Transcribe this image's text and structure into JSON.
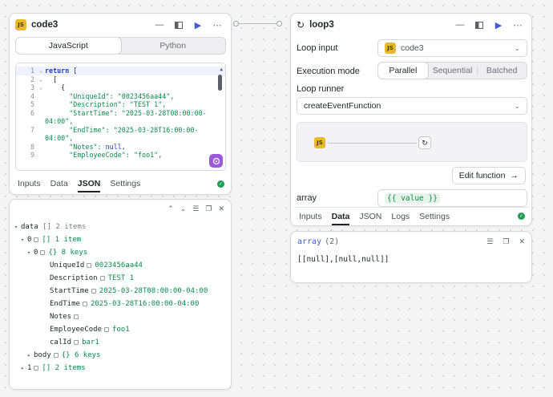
{
  "code_node": {
    "title": "code3",
    "badge": "JS",
    "language_tabs": [
      "JavaScript",
      "Python"
    ],
    "code_lines": [
      {
        "n": "1",
        "fold": "⌄",
        "text": "return ["
      },
      {
        "n": "2",
        "fold": "⌄",
        "text": "  ["
      },
      {
        "n": "3",
        "fold": "⌄",
        "text": "    {"
      },
      {
        "n": "4",
        "fold": "",
        "key": "      \"UniqueId\": ",
        "val": "\"0023456aa44\","
      },
      {
        "n": "5",
        "fold": "",
        "key": "      \"Description\": ",
        "val": "\"TEST 1\","
      },
      {
        "n": "6",
        "fold": "",
        "key": "      \"StartTime\": ",
        "val": "\"2025-03-28T08:00:00-"
      },
      {
        "n": "",
        "fold": "",
        "key": "",
        "val": "04:00\","
      },
      {
        "n": "7",
        "fold": "",
        "key": "      \"EndTime\": ",
        "val": "\"2025-03-28T16:00:00-"
      },
      {
        "n": "",
        "fold": "",
        "key": "",
        "val": "04:00\","
      },
      {
        "n": "8",
        "fold": "",
        "key": "      \"Notes\": ",
        "val": "null,"
      },
      {
        "n": "9",
        "fold": "",
        "key": "      \"EmployeeCode\": ",
        "val": "\"foo1\","
      }
    ],
    "bottom_tabs": [
      "Inputs",
      "Data",
      "JSON",
      "Settings"
    ],
    "active_tab": "JSON"
  },
  "json_panel": {
    "root": {
      "key": "data",
      "meta": "[]  2 items"
    },
    "rows": [
      {
        "indent": 0,
        "arrow": "▾",
        "key": "data",
        "meta": "[]  2 items",
        "val": ""
      },
      {
        "indent": 1,
        "arrow": "▾",
        "key": "0",
        "copy": true,
        "meta": "[]  1 item",
        "val": ""
      },
      {
        "indent": 2,
        "arrow": "▾",
        "key": "0",
        "copy": true,
        "meta": "{}  8 keys",
        "val": ""
      },
      {
        "indent": 3,
        "arrow": "",
        "key": "UniqueId",
        "copy": true,
        "meta": "",
        "val": "0023456aa44"
      },
      {
        "indent": 3,
        "arrow": "",
        "key": "Description",
        "copy": true,
        "meta": "",
        "val": "TEST 1"
      },
      {
        "indent": 3,
        "arrow": "",
        "key": "StartTime",
        "copy": true,
        "meta": "",
        "val": "2025-03-28T08:00:00-04:00"
      },
      {
        "indent": 3,
        "arrow": "",
        "key": "EndTime",
        "copy": true,
        "meta": "",
        "val": "2025-03-28T16:00:00-04:00"
      },
      {
        "indent": 3,
        "arrow": "",
        "key": "Notes",
        "copy": true,
        "meta": "",
        "val": ""
      },
      {
        "indent": 3,
        "arrow": "",
        "key": "EmployeeCode",
        "copy": true,
        "meta": "",
        "val": "foo1"
      },
      {
        "indent": 3,
        "arrow": "",
        "key": "calId",
        "copy": true,
        "meta": "",
        "val": "bar1"
      },
      {
        "indent": 2,
        "arrow": "▸",
        "key": "body",
        "copy": true,
        "meta": "{}  6 keys",
        "val": ""
      },
      {
        "indent": 1,
        "arrow": "▸",
        "key": "1",
        "copy": true,
        "meta": "[]  2 items",
        "val": ""
      }
    ]
  },
  "loop_node": {
    "title": "loop3",
    "loop_input_label": "Loop input",
    "loop_input_value": "code3",
    "execution_mode_label": "Execution mode",
    "execution_modes": [
      "Parallel",
      "Sequential",
      "Batched"
    ],
    "loop_runner_label": "Loop runner",
    "loop_runner_value": "createEventFunction",
    "edit_function_label": "Edit function",
    "array_label": "array",
    "array_value": "{{ value }}",
    "bottom_tabs": [
      "Inputs",
      "Data",
      "JSON",
      "Logs",
      "Settings"
    ],
    "active_tab": "Data"
  },
  "array_panel": {
    "title": "array",
    "count": "(2)",
    "value": "[[null],[null,null]]"
  },
  "colors": {
    "accent": "#3f5bd6",
    "success": "#1f9d55",
    "string": "#0a8b4e",
    "js_badge": "#e8b92e"
  }
}
